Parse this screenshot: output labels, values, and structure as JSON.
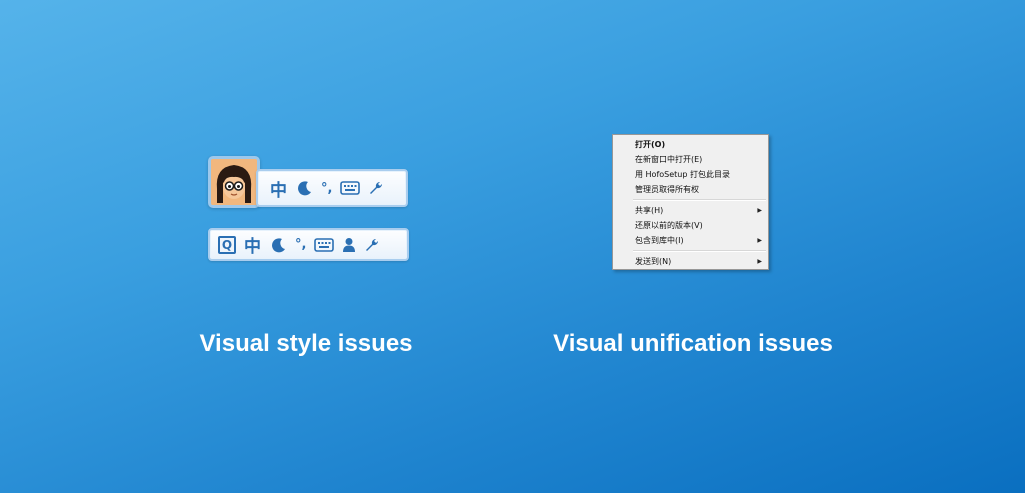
{
  "ime_toolbars": {
    "bar1": {
      "lang_char": "中",
      "punct_glyph": "°,",
      "icons": [
        "avatar-character-icon",
        "moon-icon",
        "punctuation-icon",
        "keyboard-icon",
        "wrench-icon"
      ]
    },
    "bar2": {
      "logo_letter": "Q",
      "lang_char": "中",
      "punct_glyph": "°,",
      "icons": [
        "qq-pinyin-logo-icon",
        "moon-icon",
        "punctuation-icon",
        "keyboard-icon",
        "user-icon",
        "wrench-icon"
      ]
    }
  },
  "context_menu": {
    "group1": [
      {
        "label": "打开(O)",
        "bold": true
      },
      {
        "label": "在新窗口中打开(E)"
      },
      {
        "label": "用 HofoSetup 打包此目录"
      },
      {
        "label": "管理员取得所有权"
      }
    ],
    "group2": [
      {
        "label": "共享(H)",
        "submenu": true
      },
      {
        "label": "还原以前的版本(V)"
      },
      {
        "label": "包含到库中(I)",
        "submenu": true
      }
    ],
    "group3": [
      {
        "label": "发送到(N)",
        "submenu": true
      }
    ],
    "submenu_arrow": "▶"
  },
  "captions": {
    "left": "Visual style issues",
    "right": "Visual unification issues"
  },
  "colors": {
    "background_start": "#55b3ea",
    "background_end": "#0a6fc0",
    "icon_blue": "#2a6fb3",
    "toolbar_border": "#a9cdee",
    "menu_background": "#f0f0f0"
  }
}
